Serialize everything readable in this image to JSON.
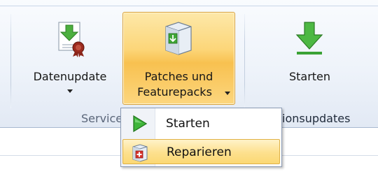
{
  "ribbon": {
    "buttons": {
      "datenupdate": {
        "label": "Datenupdate",
        "icon": "data-update-certificate-icon"
      },
      "patches": {
        "line1": "Patches und",
        "line2": "Featurepacks",
        "icon": "package-box-icon",
        "state": "pressed"
      },
      "starten": {
        "label": "Starten",
        "icon": "green-download-arrow-icon"
      }
    },
    "groups": {
      "service_partial": "Service",
      "versionsupdates_partial": "ionsupdates"
    }
  },
  "dropdown": {
    "items": [
      {
        "label": "Starten",
        "icon": "green-play-icon"
      },
      {
        "label": "Reparieren",
        "icon": "repair-box-icon",
        "state": "hovered"
      }
    ]
  },
  "colors": {
    "highlight_border": "#d9a23a",
    "highlight_fill": "#fcd679",
    "ribbon_bg": "#eef3fa",
    "accent_green": "#3aa235"
  }
}
